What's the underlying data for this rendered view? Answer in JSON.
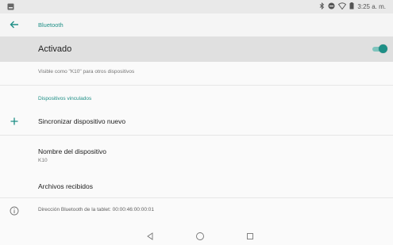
{
  "status_bar": {
    "time": "3:25 a. m.",
    "icons": [
      "notification-icon",
      "bluetooth-icon",
      "do-not-disturb-icon",
      "wifi-icon",
      "battery-icon"
    ]
  },
  "toolbar": {
    "title": "Bluetooth"
  },
  "master_switch": {
    "label": "Activado",
    "on": true
  },
  "visibility_text": "Visible como \"K10\" para otros dispositivos",
  "paired_section": {
    "header": "Dispositivos vinculados",
    "pair_new_label": "Sincronizar dispositivo nuevo"
  },
  "device_name": {
    "title": "Nombre del dispositivo",
    "value": "K10"
  },
  "received_files": {
    "label": "Archivos recibidos"
  },
  "footer_info": "Dirección Bluetooth de la tablet: 00:00:46:00:00:01",
  "nav_bar": {
    "icons": [
      "back-triangle-icon",
      "home-circle-icon",
      "recents-square-icon"
    ]
  },
  "colors": {
    "accent": "#1e8f86",
    "master_row_bg": "#e0e0e0",
    "status_bar_bg": "#e9e9e9"
  }
}
